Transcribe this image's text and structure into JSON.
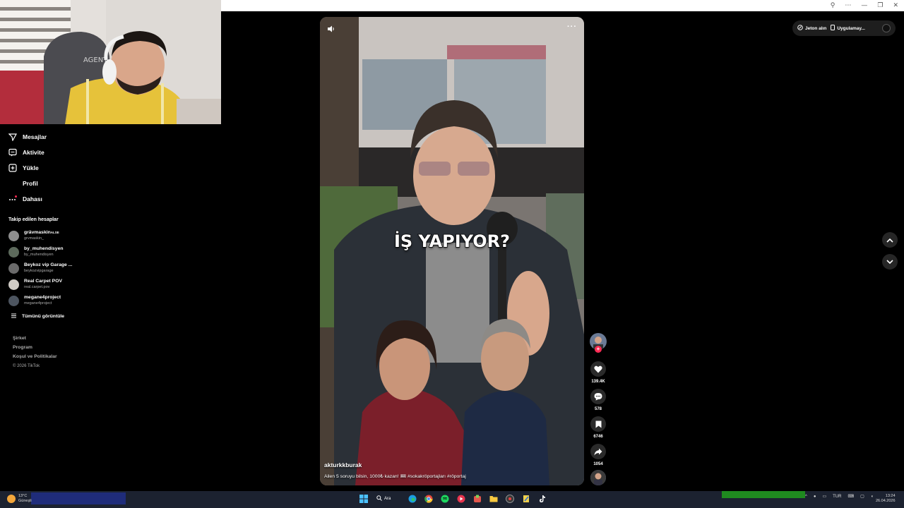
{
  "webcam": {
    "chair_text": "AGENT"
  },
  "sidebar": {
    "nav": [
      {
        "label": "Mesajlar",
        "icon": "send-icon"
      },
      {
        "label": "Aktivite",
        "icon": "activity-icon"
      },
      {
        "label": "Yükle",
        "icon": "upload-icon"
      },
      {
        "label": "Profil",
        "icon": "profile-icon"
      },
      {
        "label": "Dahası",
        "icon": "more-icon"
      }
    ],
    "followed_title": "Takip edilen hesaplar",
    "followed": [
      {
        "name": "grävmaskin",
        "suffix": "ALSE",
        "handle": "grvmaskin_"
      },
      {
        "name": "by_muhendisyen",
        "handle": "by_muhendisyen"
      },
      {
        "name": "Beykoz vip Garage ...",
        "handle": "beykozvipgarage"
      },
      {
        "name": "Real Carpet POV",
        "handle": "real.carpet.pov"
      },
      {
        "name": "megane4project",
        "handle": "megane4project"
      }
    ],
    "see_all": "Tümünü görüntüle",
    "footer": [
      "Şirket",
      "Program",
      "Koşul ve Politikalar"
    ],
    "copyright": "© 2026 TikTok"
  },
  "topright": {
    "coins": "Jeton alın",
    "app": "Uygulamay..."
  },
  "video": {
    "caption": "İŞ YAPIYOR?",
    "username": "akturkkburak",
    "description": "Ailen 5 soruyu bilsin, 1000₺ kazan! 🎟 #sokakröportajları #röportaj"
  },
  "actions": {
    "likes": "139.4K",
    "comments": "578",
    "saves": "6746",
    "shares": "1054"
  },
  "taskbar": {
    "temperature": "13°C",
    "weather": "Güneşli",
    "search": "Ara",
    "language": "TUR",
    "time": "13:24",
    "date": "26.04.2026"
  },
  "colors": {
    "accent": "#fe2c55",
    "background": "#000000",
    "taskbar": "#1c2230"
  }
}
